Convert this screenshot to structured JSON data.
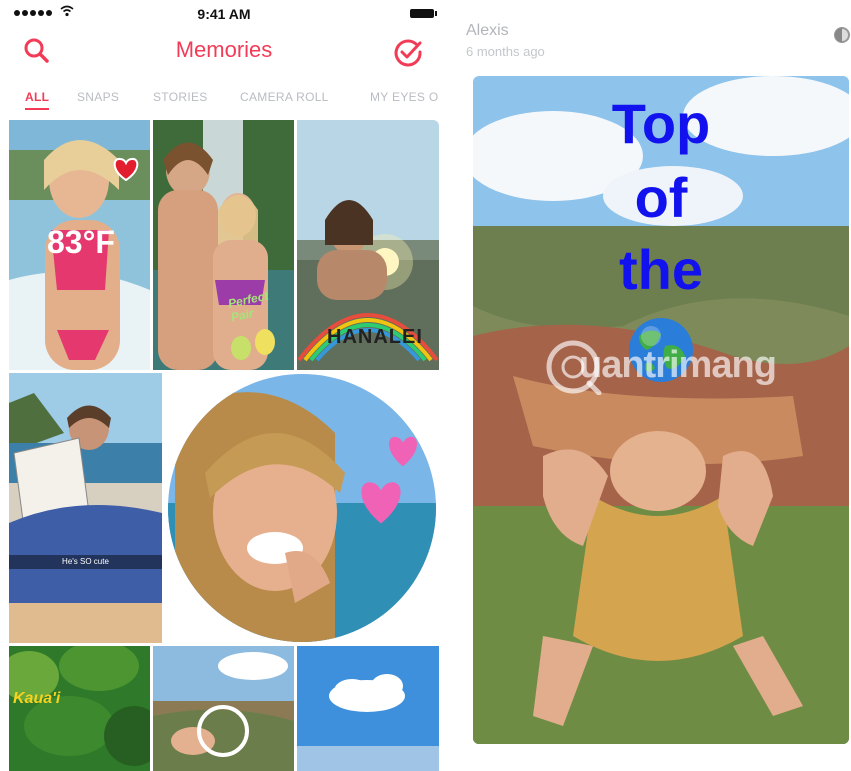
{
  "status_bar": {
    "time": "9:41 AM"
  },
  "header": {
    "title": "Memories"
  },
  "tabs": [
    {
      "label": "ALL",
      "active": true
    },
    {
      "label": "SNAPS",
      "active": false
    },
    {
      "label": "STORIES",
      "active": false
    },
    {
      "label": "CAMERA ROLL",
      "active": false
    },
    {
      "label": "MY EYES O",
      "active": false
    }
  ],
  "grid": {
    "tiles": [
      {
        "name": "beach-selfie-snap",
        "overlay_text": "83°F"
      },
      {
        "name": "waterfall-couple-snap",
        "sticker_text": "Perfect Pair"
      },
      {
        "name": "surfer-snap",
        "sticker_text": "HANALEI"
      },
      {
        "name": "reading-snap",
        "caption": "He's SO cute"
      },
      {
        "name": "smiling-girl-story"
      },
      {
        "name": "jungle-snap",
        "sticker_text": "Kaua'i"
      },
      {
        "name": "canyon-hands-snap"
      },
      {
        "name": "sky-snap"
      }
    ]
  },
  "viewer": {
    "user_name": "Alexis",
    "time_ago": "6 months ago",
    "caption_lines": [
      "Top",
      "of",
      "the"
    ],
    "caption_emoji": "globe-emoji",
    "watermark": "uantrimang"
  },
  "colors": {
    "accent": "#f23c57",
    "tab_inactive": "#b9bcc2",
    "caption_blue": "#1212ee"
  }
}
